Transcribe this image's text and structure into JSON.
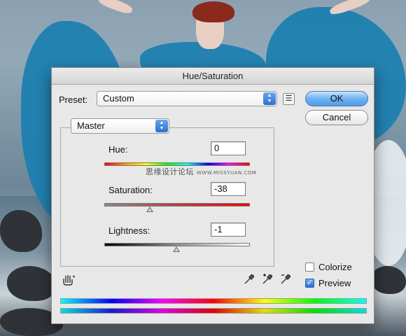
{
  "dialog": {
    "title": "Hue/Saturation",
    "preset_label": "Preset:",
    "preset_value": "Custom",
    "ok_label": "OK",
    "cancel_label": "Cancel",
    "channel_value": "Master"
  },
  "adjustments": {
    "hue_label": "Hue:",
    "hue_value": "0",
    "saturation_label": "Saturation:",
    "saturation_value": "-38",
    "lightness_label": "Lightness:",
    "lightness_value": "-1"
  },
  "options": {
    "colorize_label": "Colorize",
    "colorize_checked": false,
    "preview_label": "Preview",
    "preview_checked": true
  },
  "watermark": {
    "text": "思缘设计论坛",
    "url": "WWW.MISSYUAN.COM"
  },
  "icons": {
    "preset_options": "list-options-icon",
    "target_adjust": "hand-adjust-icon",
    "eyedropper": "eyedropper-icon",
    "eyedropper_add": "eyedropper-plus-icon",
    "eyedropper_subtract": "eyedropper-minus-icon"
  },
  "colors": {
    "ok_button": "#5aa6ee",
    "dialog_bg": "#e8e8e8",
    "dress": "#1d7fb0"
  }
}
